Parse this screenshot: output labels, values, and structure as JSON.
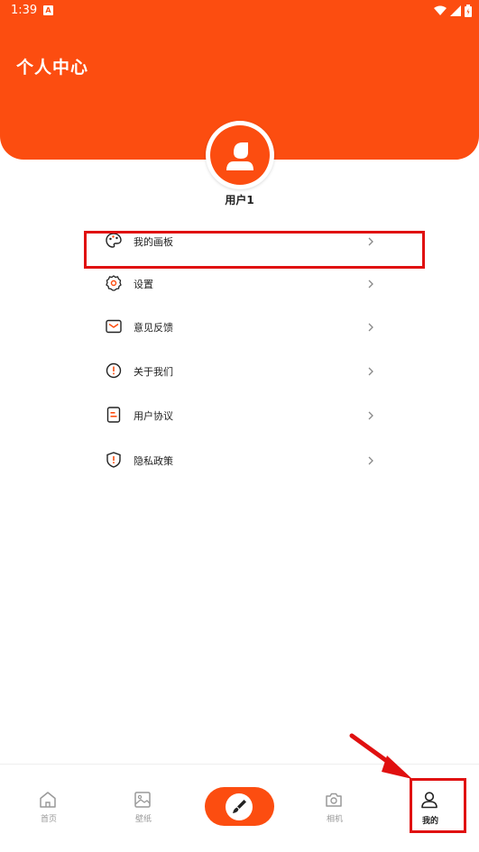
{
  "status_bar": {
    "time": "1:39",
    "notif_icon": "A"
  },
  "header": {
    "title": "个人中心",
    "accent": "#fc4d10"
  },
  "profile": {
    "username": "用户1"
  },
  "menu": {
    "items": [
      {
        "label": "我的画板",
        "icon": "palette-icon"
      },
      {
        "label": "设置",
        "icon": "gear-icon"
      },
      {
        "label": "意见反馈",
        "icon": "mail-icon"
      },
      {
        "label": "关于我们",
        "icon": "info-icon"
      },
      {
        "label": "用户协议",
        "icon": "document-icon"
      },
      {
        "label": "隐私政策",
        "icon": "shield-icon"
      }
    ]
  },
  "bottom_nav": {
    "items": [
      {
        "label": "首页",
        "icon": "home-icon"
      },
      {
        "label": "壁纸",
        "icon": "image-icon"
      },
      {
        "label": "",
        "icon": "brush-icon"
      },
      {
        "label": "相机",
        "icon": "camera-icon"
      },
      {
        "label": "我的",
        "icon": "person-icon",
        "active": true
      }
    ]
  },
  "annotation_color": "#e01010"
}
